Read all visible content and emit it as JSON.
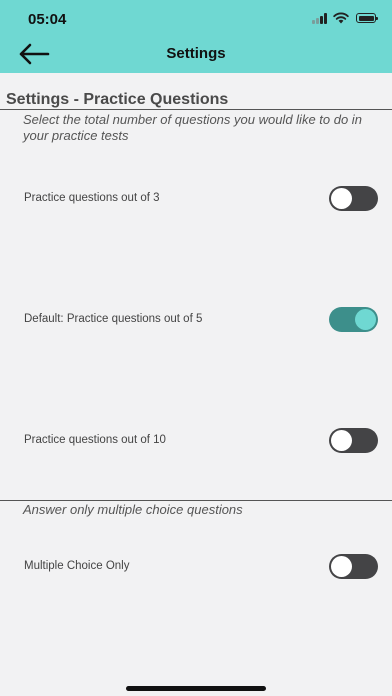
{
  "status_bar": {
    "time": "05:04",
    "icons": [
      "cellular-signal-icon",
      "wifi-icon",
      "battery-icon"
    ]
  },
  "nav": {
    "back_icon": "back-arrow-icon",
    "title": "Settings"
  },
  "section": {
    "title": "Settings - Practice Questions",
    "description": "Select the total number of questions you would like to do in your practice tests"
  },
  "options": [
    {
      "label": "Practice questions out of 3",
      "on": false
    },
    {
      "label": "Default: Practice questions out of 5",
      "on": true
    },
    {
      "label": "Practice questions out of 10",
      "on": false
    }
  ],
  "mc_section": {
    "description": "Answer only multiple choice questions",
    "option": {
      "label": "Multiple Choice Only",
      "on": false
    }
  },
  "colors": {
    "header": "#6fd8d2",
    "background": "#f2f2f3",
    "toggle_on_track": "#3d8f8b",
    "toggle_on_knob": "#6fd8d2",
    "toggle_off_track": "#444446"
  }
}
